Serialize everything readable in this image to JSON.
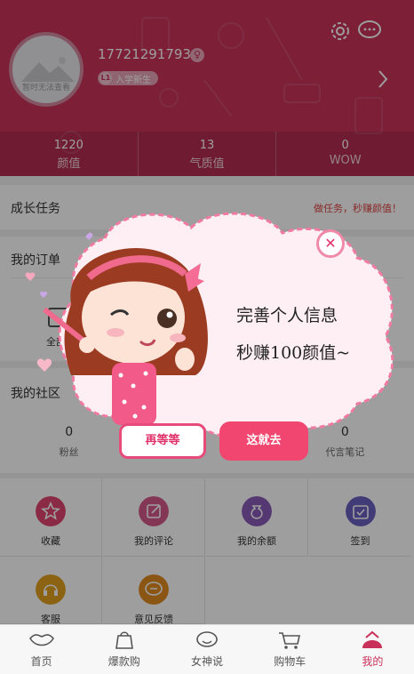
{
  "profile": {
    "avatar_caption": "暂时无法查看",
    "phone": "17721291793",
    "gender_symbol": "♀",
    "level_badge": "L1",
    "level_text": "入学新生"
  },
  "stats": [
    {
      "value": "1220",
      "label": "颜值"
    },
    {
      "value": "13",
      "label": "气质值"
    },
    {
      "value": "0",
      "label": "WOW"
    }
  ],
  "growth": {
    "title": "成长任务",
    "link": "做任务，秒赚颜值！"
  },
  "orders": {
    "title": "我的订单",
    "item_partial": "全部"
  },
  "community": {
    "title": "我的社区",
    "stats": [
      {
        "value": "0",
        "label": "粉丝"
      },
      {
        "value": "0",
        "label": "代言笔记"
      }
    ]
  },
  "grid": [
    {
      "label": "收藏",
      "icon": "star-icon",
      "color": "#e04470"
    },
    {
      "label": "我的评论",
      "icon": "edit-icon",
      "color": "#d65a8a"
    },
    {
      "label": "我的余额",
      "icon": "money-bag-icon",
      "color": "#8a5bb8"
    },
    {
      "label": "签到",
      "icon": "calendar-check-icon",
      "color": "#6a5fc0"
    },
    {
      "label": "客服",
      "icon": "headset-icon",
      "color": "#e0a020"
    },
    {
      "label": "意见反馈",
      "icon": "speech-bubble-icon",
      "color": "#e08a20"
    }
  ],
  "tabs": [
    {
      "label": "首页",
      "icon": "lips-icon"
    },
    {
      "label": "爆款购",
      "icon": "shopping-bag-icon"
    },
    {
      "label": "女神说",
      "icon": "chat-face-icon"
    },
    {
      "label": "购物车",
      "icon": "cart-icon"
    },
    {
      "label": "我的",
      "icon": "profile-hat-icon",
      "active": true
    }
  ],
  "popup": {
    "line1": "完善个人信息",
    "line2": "秒赚100颜值~",
    "close_symbol": "✕",
    "wait_button": "再等等",
    "go_button": "这就去"
  },
  "colors": {
    "brand": "#c8325a",
    "accent": "#f0466f"
  }
}
